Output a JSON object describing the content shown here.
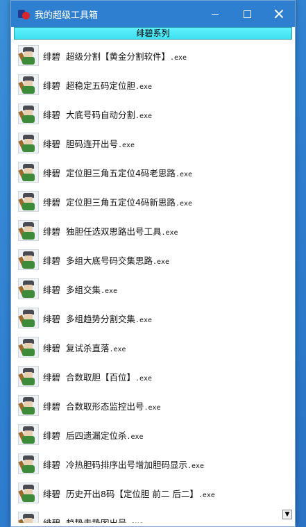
{
  "window": {
    "title": "我的超级工具箱"
  },
  "tab": {
    "label": "绯碧系列"
  },
  "items": [
    {
      "prefix": "绯碧",
      "name": "超级分割【黄金分割软件】",
      "ext": ".exe"
    },
    {
      "prefix": "绯碧",
      "name": "超稳定五码定位胆",
      "ext": ".exe"
    },
    {
      "prefix": "绯碧",
      "name": "大底号码自动分割",
      "ext": ".exe"
    },
    {
      "prefix": "绯碧",
      "name": "胆码连开出号",
      "ext": ".exe"
    },
    {
      "prefix": "绯碧",
      "name": "定位胆三角五定位4码老思路",
      "ext": ".exe"
    },
    {
      "prefix": "绯碧",
      "name": "定位胆三角五定位4码新思路",
      "ext": ".exe"
    },
    {
      "prefix": "绯碧",
      "name": "独胆任选双思路出号工具",
      "ext": ".exe"
    },
    {
      "prefix": "绯碧",
      "name": "多组大底号码交集思路",
      "ext": ".exe"
    },
    {
      "prefix": "绯碧",
      "name": "多组交集",
      "ext": ".exe"
    },
    {
      "prefix": "绯碧",
      "name": "多组趋势分割交集",
      "ext": ".exe"
    },
    {
      "prefix": "绯碧",
      "name": "复试杀直落",
      "ext": ".exe"
    },
    {
      "prefix": "绯碧",
      "name": "合数取胆【百位】",
      "ext": ".exe"
    },
    {
      "prefix": "绯碧",
      "name": "合数取形态监控出号",
      "ext": ".exe"
    },
    {
      "prefix": "绯碧",
      "name": "后四遗漏定位杀",
      "ext": ".exe"
    },
    {
      "prefix": "绯碧",
      "name": "冷热胆码排序出号增加胆码显示",
      "ext": ".exe"
    },
    {
      "prefix": "绯碧",
      "name": "历史开出8码【定位胆 前二 后二】",
      "ext": ".exe"
    },
    {
      "prefix": "绯碧",
      "name": "趋势走势图出号",
      "ext": ".exe"
    }
  ],
  "icons": {
    "item_icon": "program-icon",
    "scroll_down": "chevron-down-icon"
  }
}
